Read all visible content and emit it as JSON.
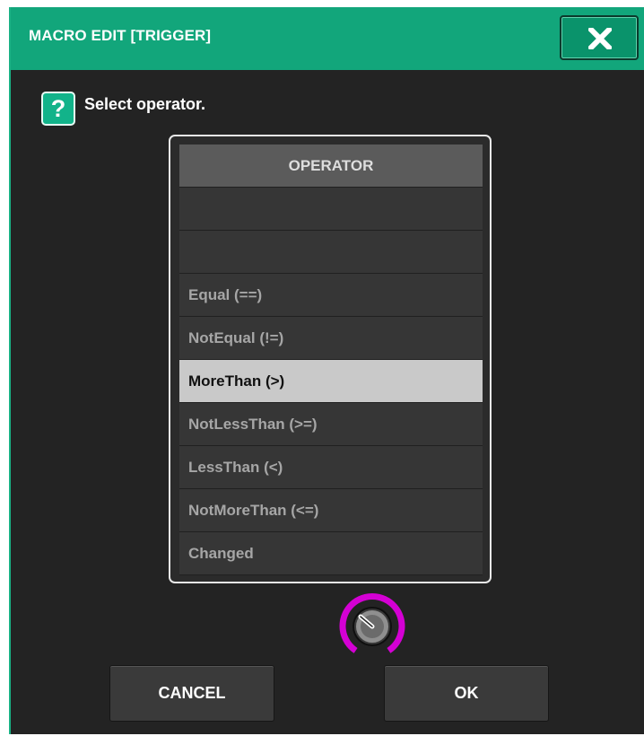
{
  "window": {
    "title": "MACRO EDIT [TRIGGER]",
    "close_icon": "close-icon",
    "accent_color": "#12a67b"
  },
  "prompt": {
    "icon": "help-icon",
    "icon_glyph": "?",
    "text": "Select operator."
  },
  "operator_list": {
    "header": "OPERATOR",
    "items": [
      "",
      "",
      "Equal (==)",
      "NotEqual (!=)",
      "MoreThan (>)",
      "NotLessThan (>=)",
      "LessThan (<)",
      "NotMoreThan (<=)",
      "Changed"
    ],
    "selected": "MoreThan (>)"
  },
  "knob": {
    "icon": "rotary-knob-icon",
    "ring_color": "#d400d4"
  },
  "buttons": {
    "cancel": "CANCEL",
    "ok": "OK"
  }
}
